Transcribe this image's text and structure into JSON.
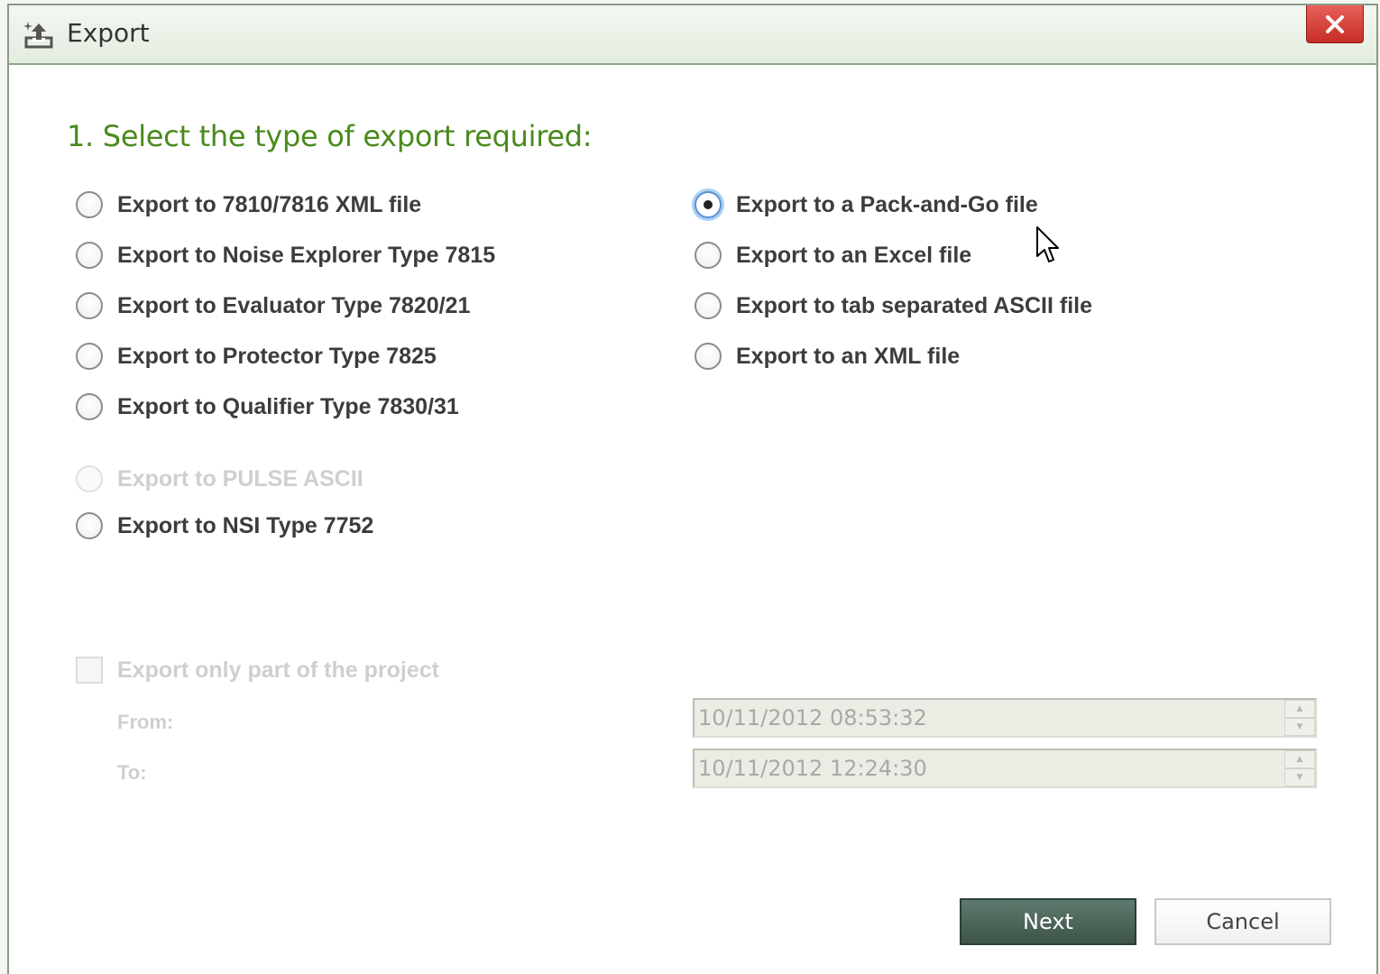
{
  "window": {
    "title": "Export",
    "close_label": "X"
  },
  "heading": "1. Select the type of export required:",
  "options_left": [
    {
      "label": "Export to 7810/7816 XML file",
      "checked": false,
      "enabled": true
    },
    {
      "label": "Export to Noise Explorer Type 7815",
      "checked": false,
      "enabled": true
    },
    {
      "label": "Export to Evaluator Type 7820/21",
      "checked": false,
      "enabled": true
    },
    {
      "label": "Export to Protector Type 7825",
      "checked": false,
      "enabled": true
    },
    {
      "label": "Export to Qualifier Type 7830/31",
      "checked": false,
      "enabled": true
    },
    {
      "label": "Export to PULSE ASCII",
      "checked": false,
      "enabled": false
    },
    {
      "label": "Export to NSI Type 7752",
      "checked": false,
      "enabled": true
    }
  ],
  "options_right": [
    {
      "label": "Export to a Pack-and-Go file",
      "checked": true,
      "enabled": true
    },
    {
      "label": "Export to an Excel file",
      "checked": false,
      "enabled": true
    },
    {
      "label": "Export to tab separated ASCII file",
      "checked": false,
      "enabled": true
    },
    {
      "label": "Export to an XML file",
      "checked": false,
      "enabled": true
    }
  ],
  "partial": {
    "checkbox_label": "Export only part of the project",
    "checked": false,
    "enabled": false,
    "from_label": "From:",
    "from_value": "10/11/2012 08:53:32",
    "to_label": "To:",
    "to_value": "10/11/2012 12:24:30"
  },
  "buttons": {
    "next": "Next",
    "cancel": "Cancel"
  },
  "colors": {
    "heading": "#4a8a1c",
    "next_button": "#4a6357",
    "close_button": "#d9443c"
  }
}
